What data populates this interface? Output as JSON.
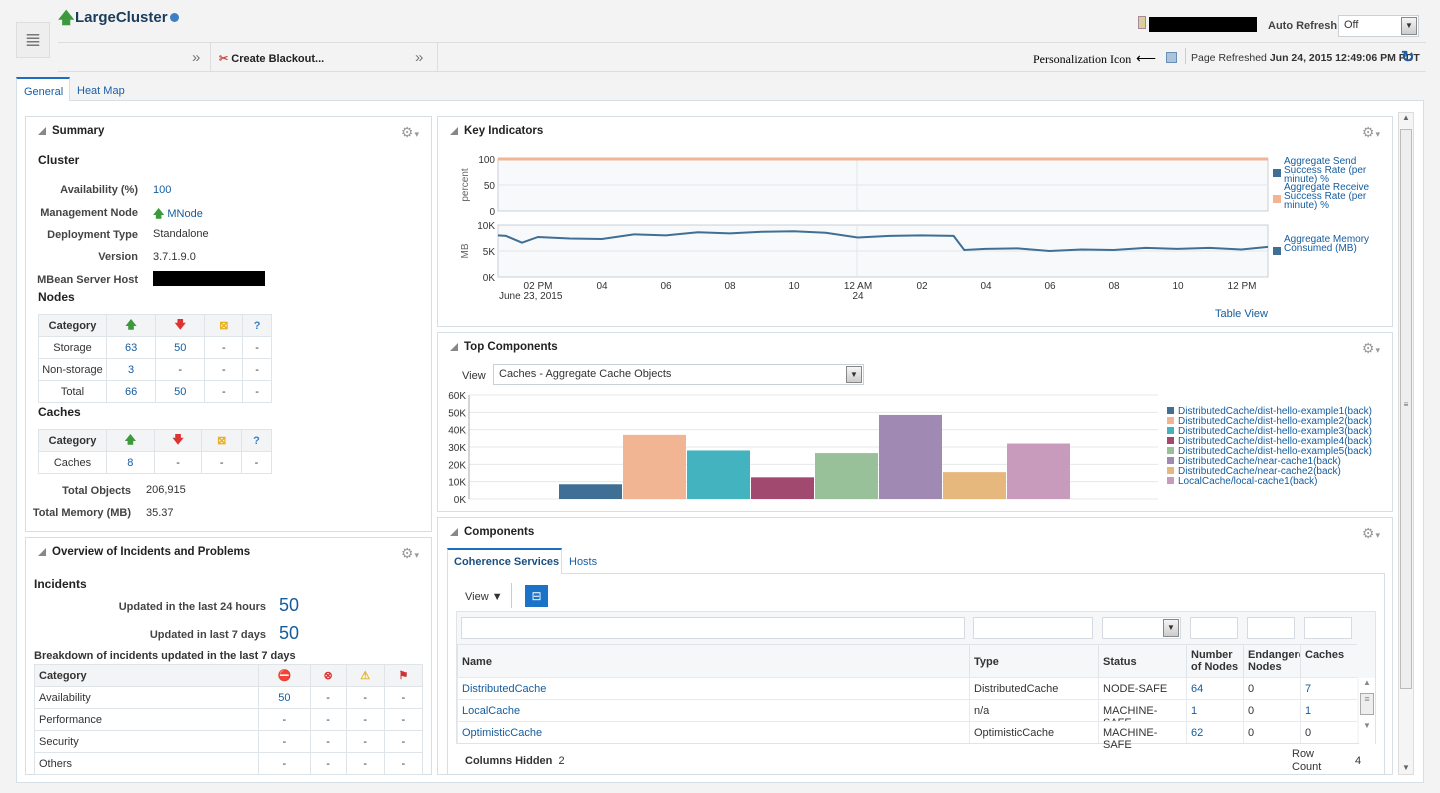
{
  "header": {
    "title": "LargeCluster",
    "auto_refresh_label": "Auto Refresh",
    "auto_refresh_value": "Off",
    "personalization_annotation": "Personalization Icon",
    "page_refreshed_label": "Page Refreshed",
    "page_refreshed_value": "Jun 24, 2015 12:49:06 PM PDT",
    "create_blackout": "Create Blackout...",
    "more": "»"
  },
  "tabs": [
    "General",
    "Heat Map"
  ],
  "summary": {
    "title": "Summary",
    "cluster_heading": "Cluster",
    "fields": [
      {
        "label": "Availability (%)",
        "value": "100"
      },
      {
        "label": "Management Node",
        "value": "MNode"
      },
      {
        "label": "Deployment Type",
        "value": "Standalone"
      },
      {
        "label": "Version",
        "value": "3.7.1.9.0"
      },
      {
        "label": "MBean Server Host",
        "value": ""
      }
    ],
    "nodes_heading": "Nodes",
    "category_header": "Category",
    "nodes_rows": [
      [
        "Storage",
        "63",
        "50",
        "-",
        "-"
      ],
      [
        "Non-storage",
        "3",
        "-",
        "-",
        "-"
      ],
      [
        "Total",
        "66",
        "50",
        "-",
        "-"
      ]
    ],
    "caches_heading": "Caches",
    "caches_rows": [
      [
        "Caches",
        "8",
        "-",
        "-",
        "-"
      ]
    ],
    "total_objects_label": "Total Objects",
    "total_objects": "206,915",
    "total_memory_label": "Total Memory (MB)",
    "total_memory": "35.37"
  },
  "incidents": {
    "title": "Overview of Incidents and Problems",
    "heading": "Incidents",
    "last24_label": "Updated in the last 24 hours",
    "last24": "50",
    "last7_label": "Updated in last 7 days",
    "last7": "50",
    "breakdown_label": "Breakdown of incidents updated in the last 7 days",
    "category_header": "Category",
    "rows": [
      [
        "Availability",
        "50",
        "-",
        "-",
        "-"
      ],
      [
        "Performance",
        "-",
        "-",
        "-",
        "-"
      ],
      [
        "Security",
        "-",
        "-",
        "-",
        "-"
      ],
      [
        "Others",
        "-",
        "-",
        "-",
        "-"
      ]
    ]
  },
  "key_indicators": {
    "title": "Key Indicators",
    "table_view": "Table View"
  },
  "top_components": {
    "title": "Top Components",
    "view_label": "View",
    "view_value": "Caches - Aggregate Cache Objects"
  },
  "components": {
    "title": "Components",
    "tabs": [
      "Coherence Services",
      "Hosts"
    ],
    "view_menu": "View ▼",
    "columns": [
      "Name",
      "Type",
      "Status",
      "Number of Nodes",
      "Endangered Nodes",
      "Caches"
    ],
    "rows": [
      [
        "DistributedCache",
        "DistributedCache",
        "NODE-SAFE",
        "64",
        "0",
        "7"
      ],
      [
        "LocalCache",
        "n/a",
        "MACHINE-SAFE",
        "1",
        "0",
        "1"
      ],
      [
        "OptimisticCache",
        "OptimisticCache",
        "MACHINE-SAFE",
        "62",
        "0",
        "0"
      ]
    ],
    "columns_hidden_label": "Columns Hidden",
    "columns_hidden": "2",
    "row_count_label": "Row Count",
    "row_count": "4"
  },
  "chart_data": [
    {
      "type": "line",
      "ylabel": "percent",
      "ylim": [
        0,
        100
      ],
      "yticks": [
        "0",
        "50",
        "100"
      ],
      "xticks": [
        "02 PM",
        "04",
        "06",
        "08",
        "10",
        "12 AM",
        "02",
        "04",
        "06",
        "08",
        "10",
        "12 PM"
      ],
      "xsub": [
        "June 23, 2015",
        "",
        "",
        "",
        "",
        "24"
      ],
      "series": [
        {
          "name": "Aggregate Send Success Rate (per minute) %",
          "color": "#3f6f94",
          "x": [
            "2015-06-23 12:45",
            "2015-06-24 12:50"
          ],
          "values": [
            100,
            100
          ]
        },
        {
          "name": "Aggregate Receive Success Rate (per minute) %",
          "color": "#f2b593",
          "x": [
            "2015-06-23 12:45",
            "2015-06-24 12:50"
          ],
          "values": [
            100,
            100
          ]
        }
      ]
    },
    {
      "type": "line",
      "ylabel": "MB",
      "ylim": [
        0,
        10000
      ],
      "yticks": [
        "0K",
        "5K",
        "10K"
      ],
      "series": [
        {
          "name": "Aggregate Memory Consumed (MB)",
          "color": "#3f6f94",
          "x": [
            "2015-06-23 12:45",
            "2015-06-23 13:00",
            "2015-06-23 13:30",
            "2015-06-23 14:00",
            "2015-06-23 15:00",
            "2015-06-23 16:00",
            "2015-06-23 17:00",
            "2015-06-23 18:00",
            "2015-06-23 19:00",
            "2015-06-23 20:00",
            "2015-06-23 21:00",
            "2015-06-23 22:00",
            "2015-06-23 23:00",
            "2015-06-24 00:00",
            "2015-06-24 01:00",
            "2015-06-24 02:00",
            "2015-06-24 03:00",
            "2015-06-24 03:20",
            "2015-06-24 04:00",
            "2015-06-24 05:00",
            "2015-06-24 06:00",
            "2015-06-24 07:00",
            "2015-06-24 08:00",
            "2015-06-24 09:00",
            "2015-06-24 10:00",
            "2015-06-24 11:00",
            "2015-06-24 12:00",
            "2015-06-24 12:50"
          ],
          "values": [
            8000,
            7900,
            6600,
            7700,
            7400,
            7300,
            8200,
            8000,
            8600,
            8400,
            8700,
            8800,
            8500,
            7600,
            7900,
            8000,
            7900,
            5200,
            5400,
            5500,
            5000,
            5300,
            5200,
            5600,
            5400,
            5600,
            5300,
            5800
          ]
        }
      ]
    },
    {
      "type": "bar",
      "ylim": [
        0,
        60000
      ],
      "yticks": [
        "0K",
        "10K",
        "20K",
        "30K",
        "40K",
        "50K",
        "60K"
      ],
      "categories": [
        "DistributedCache/dist-hello-example1(back)",
        "DistributedCache/dist-hello-example2(back)",
        "DistributedCache/dist-hello-example3(back)",
        "DistributedCache/dist-hello-example4(back)",
        "DistributedCache/dist-hello-example5(back)",
        "DistributedCache/near-cache1(back)",
        "DistributedCache/near-cache2(back)",
        "LocalCache/local-cache1(back)"
      ],
      "values": [
        8500,
        37000,
        28000,
        12500,
        26500,
        48500,
        15500,
        32000
      ],
      "colors": [
        "#3f6f94",
        "#f2b593",
        "#43b3bf",
        "#a1496f",
        "#98c19a",
        "#a08ab4",
        "#e6b87d",
        "#c89bbd"
      ],
      "legend": "right"
    }
  ]
}
